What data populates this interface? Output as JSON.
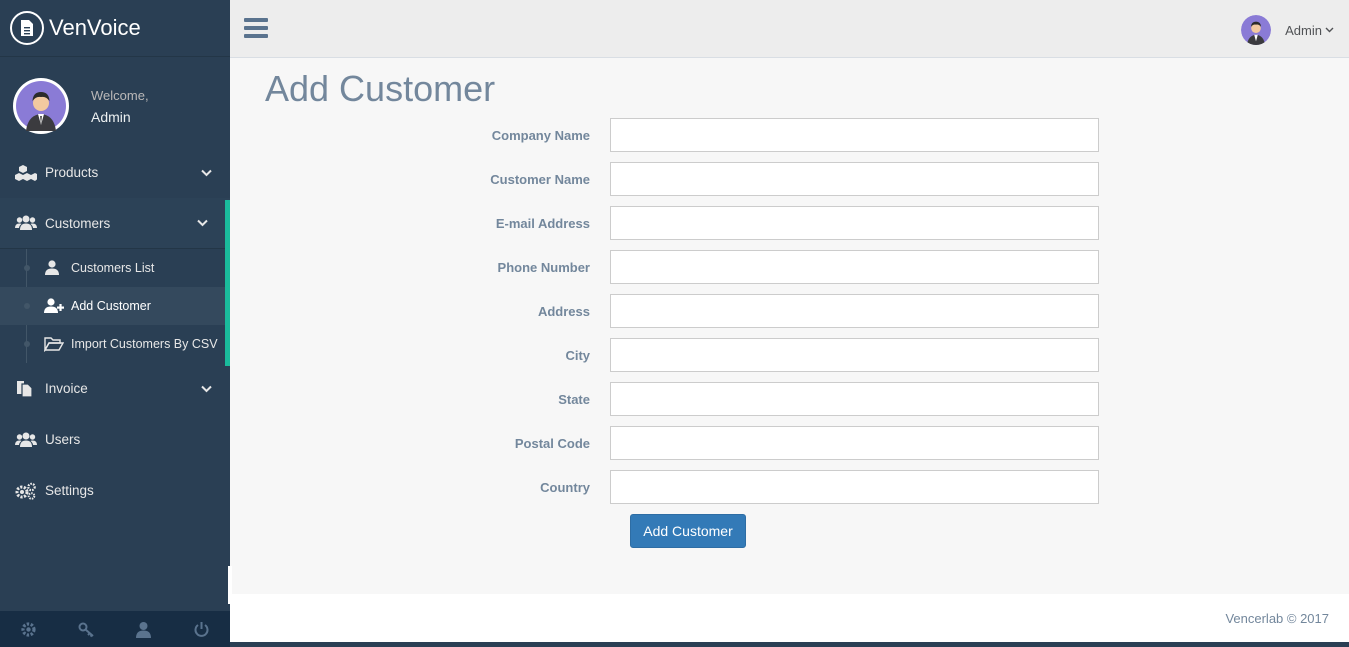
{
  "brand": {
    "name": "VenVoice",
    "logo_icon": "document-icon"
  },
  "profile": {
    "welcome": "Welcome,",
    "name": "Admin"
  },
  "menu": {
    "items": [
      {
        "label": "Products",
        "icon": "cubes-icon",
        "expanded": false
      },
      {
        "label": "Customers",
        "icon": "users-icon",
        "expanded": true,
        "children": [
          {
            "label": "Customers List",
            "icon": "user-icon"
          },
          {
            "label": "Add Customer",
            "icon": "user-plus-icon",
            "current": true
          },
          {
            "label": "Import Customers By CSV",
            "icon": "folder-open-icon"
          }
        ]
      },
      {
        "label": "Invoice",
        "icon": "files-icon",
        "expanded": false
      },
      {
        "label": "Users",
        "icon": "users-icon"
      },
      {
        "label": "Settings",
        "icon": "cogs-icon"
      }
    ]
  },
  "topnav": {
    "user_label": "Admin"
  },
  "page": {
    "title": "Add Customer",
    "fields": [
      {
        "label": "Company Name",
        "value": ""
      },
      {
        "label": "Customer Name",
        "value": ""
      },
      {
        "label": "E-mail Address",
        "value": ""
      },
      {
        "label": "Phone Number",
        "value": ""
      },
      {
        "label": "Address",
        "value": ""
      },
      {
        "label": "City",
        "value": ""
      },
      {
        "label": "State",
        "value": ""
      },
      {
        "label": "Postal Code",
        "value": ""
      },
      {
        "label": "Country",
        "value": ""
      }
    ],
    "submit_label": "Add Customer"
  },
  "footer": {
    "text": "Vencerlab © 2017"
  },
  "colors": {
    "sidebar": "#2a3f54",
    "accent": "#1abb9c",
    "primary_button": "#337ab7",
    "title_text": "#73879c"
  }
}
